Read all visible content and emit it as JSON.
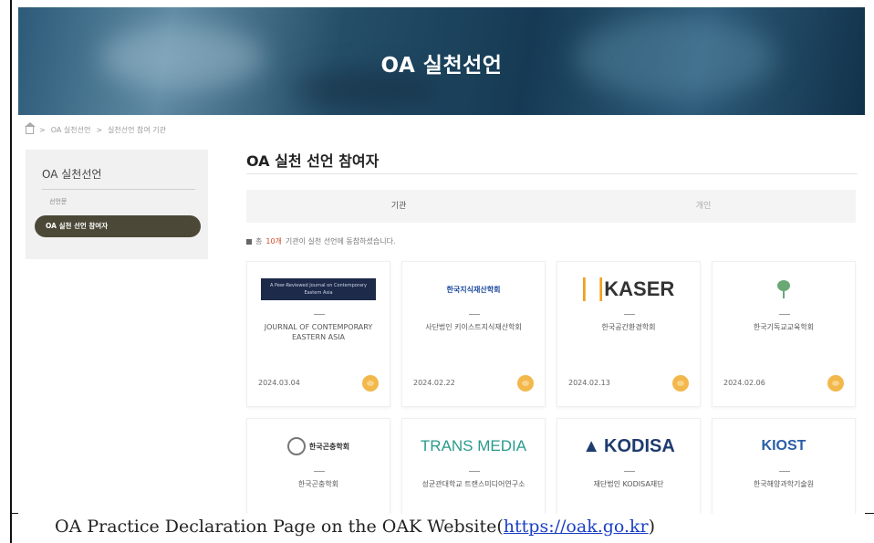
{
  "hero": {
    "title": "OA 실천선언"
  },
  "breadcrumb": {
    "items": [
      "OA 실천선언",
      "실천선언 참여 기관"
    ]
  },
  "sidebar": {
    "title": "OA 실천선언",
    "sub_item": "선언문",
    "active_item": "OA 실천 선언 참여자"
  },
  "main": {
    "title": "OA 실천 선언 참여자",
    "tabs": [
      {
        "label": "기관",
        "active": true
      },
      {
        "label": "개인",
        "active": false
      }
    ],
    "summary": {
      "prefix": "총",
      "count": "10개",
      "suffix": "기관이 실천 선언에 동참하셨습니다."
    }
  },
  "cards": [
    {
      "logo": "A Peer-Reviewed Journal on Contemporary Eastern Asia",
      "name": "JOURNAL OF CONTEMPORARY EASTERN ASIA",
      "date": "2024.03.04"
    },
    {
      "logo": "한국지식재산학회",
      "name": "사단법인 키이스트지식재산학회",
      "date": "2024.02.22"
    },
    {
      "logo": "KASER",
      "name": "한국공간환경학회",
      "date": "2024.02.13"
    },
    {
      "logo": "",
      "name": "한국기독교교육학회",
      "date": "2024.02.06"
    },
    {
      "logo": "한국곤충학회",
      "name": "한국곤충학회",
      "date": ""
    },
    {
      "logo": "TRANS MEDIA",
      "name": "성균관대학교 트랜스미디어연구소",
      "date": ""
    },
    {
      "logo": "KODISA",
      "name": "재단법인 KODISA재단",
      "date": ""
    },
    {
      "logo": "KIOST",
      "name": "한국해양과학기술원",
      "date": ""
    }
  ],
  "caption": {
    "text": "OA Practice Declaration Page on the OAK Website(",
    "link": "https://oak.go.kr",
    "close": ")"
  },
  "colors": {
    "sidebar_active": "#4b4837",
    "badge": "#f2b84b",
    "hero": "#244e68"
  }
}
